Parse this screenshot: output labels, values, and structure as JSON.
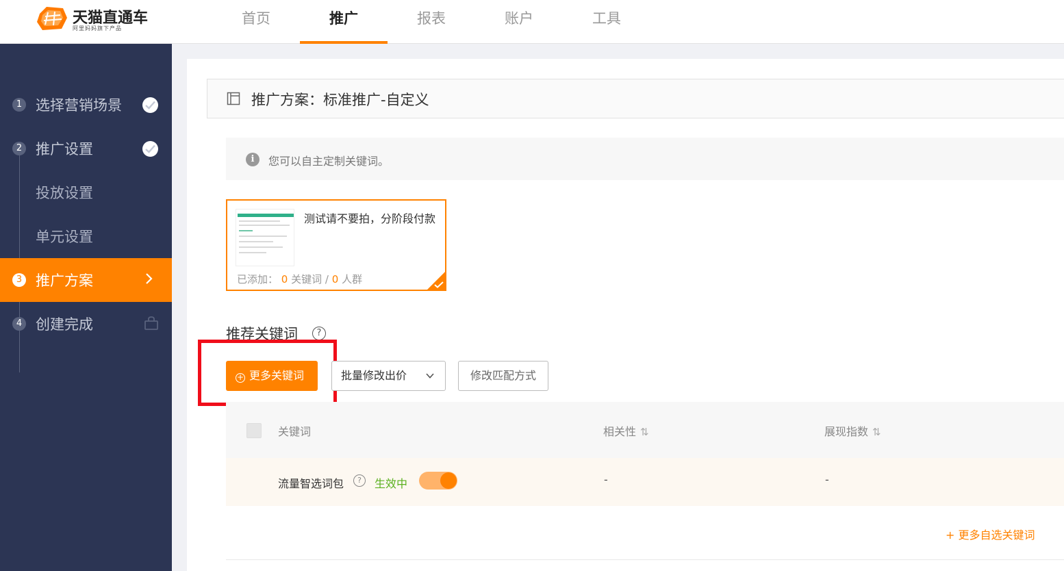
{
  "app": {
    "logo_title": "天猫直通车",
    "logo_sub": "阿里妈妈旗下产品"
  },
  "nav": {
    "items": [
      {
        "label": "首页"
      },
      {
        "label": "推广"
      },
      {
        "label": "报表"
      },
      {
        "label": "账户"
      },
      {
        "label": "工具"
      }
    ],
    "active": "推广"
  },
  "sidebar": {
    "steps": [
      {
        "num": "1",
        "label": "选择营销场景",
        "state": "done"
      },
      {
        "num": "2",
        "label": "推广设置",
        "state": "done"
      },
      {
        "num": "",
        "label": "投放设置",
        "state": "sub"
      },
      {
        "num": "",
        "label": "单元设置",
        "state": "sub"
      },
      {
        "num": "3",
        "label": "推广方案",
        "state": "active"
      },
      {
        "num": "4",
        "label": "创建完成",
        "state": "locked"
      }
    ]
  },
  "plan": {
    "title": "推广方案：标准推广-自定义"
  },
  "tip": {
    "text": "您可以自主定制关键词。"
  },
  "unit_card": {
    "name": "测试请不要拍，分阶段付款",
    "added_label": "已添加：",
    "keyword_count": "0",
    "keyword_label": "关键词 /",
    "crowd_count": "0",
    "crowd_label": "人群"
  },
  "keywords_section": {
    "title": "推荐关键词",
    "help": "?",
    "more_keywords_button": "更多关键词",
    "bulk_bid_dropdown": "批量修改出价",
    "match_mode_button": "修改匹配方式",
    "columns": {
      "keyword": "关键词",
      "relevance": "相关性",
      "impression_index": "展现指数"
    },
    "rows": [
      {
        "keyword": "流量智选词包",
        "status": "生效中",
        "enabled": true,
        "relevance": "-",
        "impression_index": "-"
      }
    ],
    "more_custom_link": "+ 更多自选关键词"
  },
  "colors": {
    "accent": "#ff8200",
    "sidebar_bg": "#2c3554",
    "highlight_box": "#f00e1a",
    "status_green": "#5ab01e"
  }
}
